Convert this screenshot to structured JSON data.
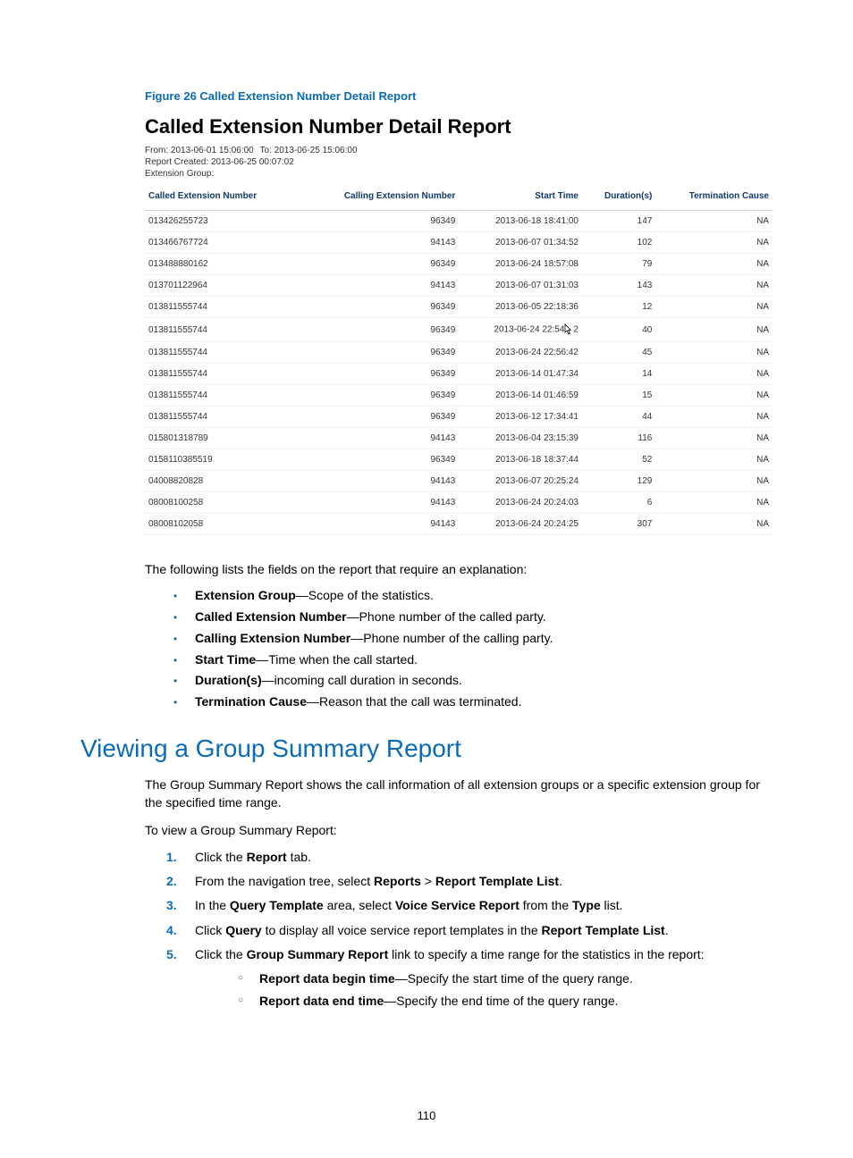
{
  "figure": {
    "caption": "Figure 26 Called Extension Number Detail Report",
    "title": "Called Extension Number Detail Report",
    "from_label": "From:",
    "from_value": "2013-06-01 15:06:00",
    "to_label": "To:",
    "to_value": "2013-06-25 15:06:00",
    "created_label": "Report Created:",
    "created_value": "2013-06-25 00:07:02",
    "group_label": "Extension Group:",
    "headers": [
      "Called Extension Number",
      "Calling Extension Number",
      "Start Time",
      "Duration(s)",
      "Termination Cause"
    ],
    "rows": [
      [
        "013426255723",
        "96349",
        "2013-06-18 18:41:00",
        "147",
        "NA"
      ],
      [
        "013466767724",
        "94143",
        "2013-06-07 01:34:52",
        "102",
        "NA"
      ],
      [
        "013488880162",
        "96349",
        "2013-06-24 18:57:08",
        "79",
        "NA"
      ],
      [
        "013701122964",
        "94143",
        "2013-06-07 01:31:03",
        "143",
        "NA"
      ],
      [
        "013811555744",
        "96349",
        "2013-06-05 22:18:36",
        "12",
        "NA"
      ],
      [
        "013811555744",
        "96349",
        "2013-06-24 22:54:32",
        "40",
        "NA"
      ],
      [
        "013811555744",
        "96349",
        "2013-06-24 22:56:42",
        "45",
        "NA"
      ],
      [
        "013811555744",
        "96349",
        "2013-06-14 01:47:34",
        "14",
        "NA"
      ],
      [
        "013811555744",
        "96349",
        "2013-06-14 01:46:59",
        "15",
        "NA"
      ],
      [
        "013811555744",
        "96349",
        "2013-06-12 17:34:41",
        "44",
        "NA"
      ],
      [
        "015801318789",
        "94143",
        "2013-06-04 23:15:39",
        "116",
        "NA"
      ],
      [
        "0158110385519",
        "96349",
        "2013-06-18 18:37:44",
        "52",
        "NA"
      ],
      [
        "04008820828",
        "94143",
        "2013-06-07 20:25:24",
        "129",
        "NA"
      ],
      [
        "08008100258",
        "94143",
        "2013-06-24 20:24:03",
        "6",
        "NA"
      ],
      [
        "08008102058",
        "94143",
        "2013-06-24 20:24:25",
        "307",
        "NA"
      ]
    ]
  },
  "explain": {
    "intro": "The following lists the fields on the report that require an explanation:",
    "items": [
      {
        "term": "Extension Group",
        "desc": "—Scope of the statistics."
      },
      {
        "term": "Called Extension Number",
        "desc": "—Phone number of the called party."
      },
      {
        "term": "Calling Extension Number",
        "desc": "—Phone number of the calling party."
      },
      {
        "term": "Start Time",
        "desc": "—Time when the call started."
      },
      {
        "term": "Duration(s)",
        "desc": "—incoming call duration in seconds."
      },
      {
        "term": "Termination Cause",
        "desc": "—Reason that the call was terminated."
      }
    ]
  },
  "section": {
    "heading": "Viewing a Group Summary Report",
    "p1": "The Group Summary Report shows the call information of all extension groups or a specific extension group for the specified time range.",
    "p2": "To view a Group Summary Report:",
    "steps": {
      "s1_a": "Click the ",
      "s1_b": "Report",
      "s1_c": " tab.",
      "s2_a": "From the navigation tree, select ",
      "s2_b": "Reports",
      "s2_c": " > ",
      "s2_d": "Report Template List",
      "s2_e": ".",
      "s3_a": "In the ",
      "s3_b": "Query Template",
      "s3_c": " area, select ",
      "s3_d": "Voice Service Report",
      "s3_e": " from the ",
      "s3_f": "Type",
      "s3_g": " list.",
      "s4_a": "Click ",
      "s4_b": "Query",
      "s4_c": " to display all voice service report templates in the ",
      "s4_d": "Report Template List",
      "s4_e": ".",
      "s5_a": "Click the ",
      "s5_b": "Group Summary Report",
      "s5_c": " link to specify a time range for the statistics in the report:",
      "sub1_a": "Report data begin time",
      "sub1_b": "—Specify the start time of the query range.",
      "sub2_a": "Report data end time",
      "sub2_b": "—Specify the end time of the query range."
    },
    "nums": {
      "1": "1.",
      "2": "2.",
      "3": "3.",
      "4": "4.",
      "5": "5."
    }
  },
  "pagenum": "110"
}
